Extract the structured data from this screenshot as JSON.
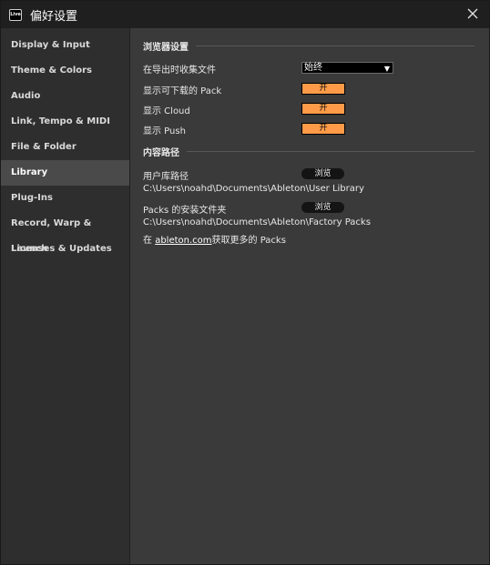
{
  "window": {
    "logo_text": "Live",
    "title": "偏好设置"
  },
  "sidebar": {
    "items": [
      {
        "label": "Display & Input"
      },
      {
        "label": "Theme & Colors"
      },
      {
        "label": "Audio"
      },
      {
        "label": "Link, Tempo & MIDI"
      },
      {
        "label": "File & Folder"
      },
      {
        "label": "Library",
        "active": true
      },
      {
        "label": "Plug-Ins"
      },
      {
        "label": "Record, Warp & Launch"
      },
      {
        "label": "Licenses & Updates"
      }
    ]
  },
  "browser_settings": {
    "heading": "浏览器设置",
    "collect_on_export": {
      "label": "在导出时收集文件",
      "value": "始终"
    },
    "show_downloadable_packs": {
      "label": "显示可下载的 Pack",
      "value": "开"
    },
    "show_cloud": {
      "label": "显示 Cloud",
      "value": "开"
    },
    "show_push": {
      "label": "显示 Push",
      "value": "开"
    }
  },
  "content_paths": {
    "heading": "内容路径",
    "user_library": {
      "label": "用户库路径",
      "button": "浏览",
      "path": "C:\\Users\\noahd\\Documents\\Ableton\\User Library"
    },
    "packs_folder": {
      "label": "Packs 的安装文件夹",
      "button": "浏览",
      "path": "C:\\Users\\noahd\\Documents\\Ableton\\Factory Packs"
    },
    "more_packs": {
      "prefix": "在 ",
      "link": "ableton.com",
      "suffix": "获取更多的 Packs"
    }
  }
}
